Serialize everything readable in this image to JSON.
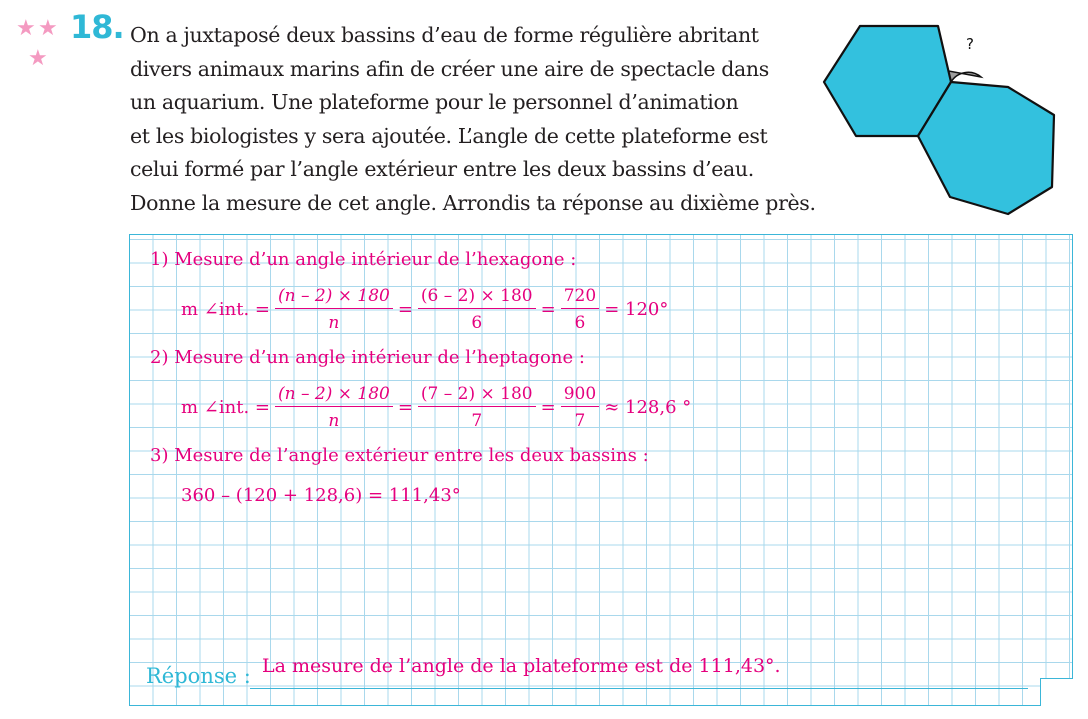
{
  "exercise": {
    "number": "18.",
    "difficulty_stars": 3,
    "statement_lines": [
      "On a juxtaposé deux bassins d’eau de forme régulière abritant",
      "divers animaux marins afin de créer une aire de spectacle dans",
      "un aquarium. Une plateforme pour le personnel d’animation",
      "et les biologistes y sera ajoutée. L’angle de cette plateforme est",
      "celui formé par l’angle extérieur entre les deux bassins d’eau.",
      "Donne la mesure de cet angle. Arrondis ta réponse au dixième près."
    ],
    "figure": {
      "question_mark": "?",
      "shape_color": "#33c1de",
      "angle_color": "#9d9d9d"
    }
  },
  "solution": {
    "step1": {
      "label": "1)  Mesure d’un angle intérieur de l’hexagone :",
      "lhs": "m ∠int. =",
      "f1_num": "(n – 2) × 180",
      "f1_den": "n",
      "eq": "=",
      "f2_num": "(6 – 2) × 180",
      "f2_den": "6",
      "f3_num": "720",
      "f3_den": "6",
      "result": "= 120°"
    },
    "step2": {
      "label": "2)  Mesure d’un angle intérieur de l’heptagone :",
      "lhs": "m ∠int. =",
      "f1_num": "(n – 2) × 180",
      "f1_den": "n",
      "eq": "=",
      "f2_num": "(7 – 2) × 180",
      "f2_den": "7",
      "f3_num": "900",
      "f3_den": "7",
      "result": "≈ 128,6 °"
    },
    "step3": {
      "label": "3)  Mesure de l’angle extérieur entre les deux bassins :",
      "calc": "360 – (120 + 128,6) = 111,43°"
    }
  },
  "answer": {
    "label": "Réponse :",
    "text": "La mesure de l’angle de la plateforme est de 111,43°."
  },
  "colors": {
    "accent_blue": "#2fb8d6",
    "solution_magenta": "#e5007e",
    "star_pink": "#f49ac1",
    "grid": "#a9d8ec"
  }
}
